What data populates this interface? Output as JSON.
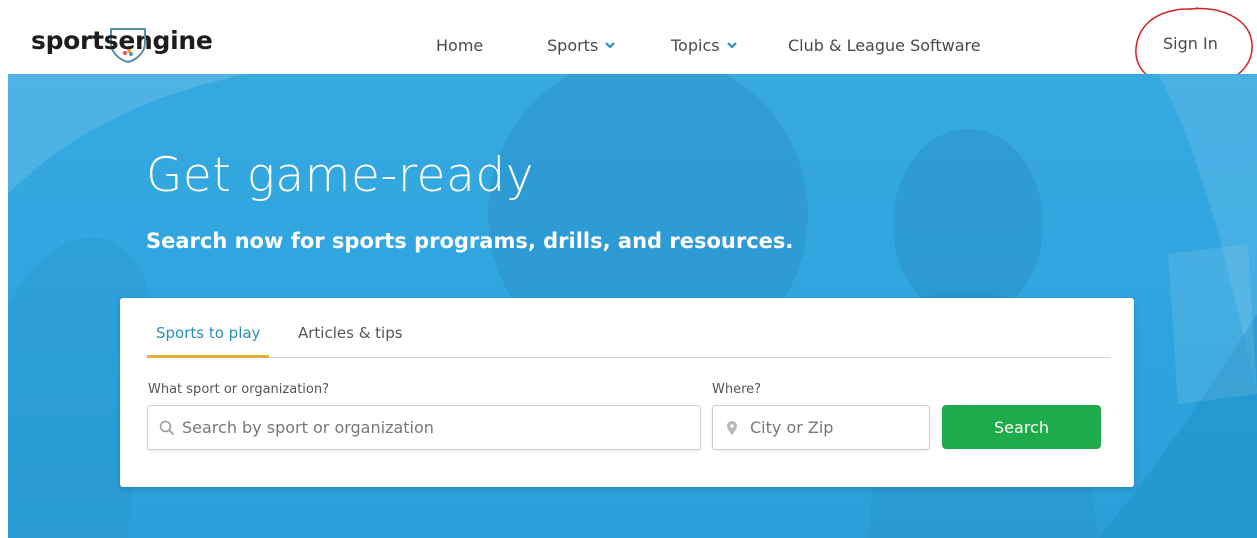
{
  "brand": {
    "logo_text": "sportsengine"
  },
  "nav": {
    "items": [
      {
        "label": "Home"
      },
      {
        "label": "Sports"
      },
      {
        "label": "Topics"
      },
      {
        "label": "Club & League Software"
      }
    ],
    "sign_in": "Sign In"
  },
  "hero": {
    "title": "Get game-ready",
    "subtitle": "Search now for sports programs, drills, and resources."
  },
  "search_card": {
    "tabs": [
      {
        "label": "Sports to play",
        "active": true
      },
      {
        "label": "Articles & tips",
        "active": false
      }
    ],
    "sport_label": "What sport or organization?",
    "sport_placeholder": "Search by sport or organization",
    "where_label": "Where?",
    "where_placeholder": "City or Zip",
    "search_button": "Search"
  },
  "colors": {
    "hero_bg": "#2ea4df",
    "tab_active_text": "#2a8fb8",
    "tab_underline": "#e3b13a",
    "search_button_bg": "#1faa4b",
    "annotation_circle": "#d42020"
  },
  "icons": {
    "search": "magnifier-icon",
    "location": "map-pin-icon",
    "dropdown": "chevron-down-icon"
  }
}
